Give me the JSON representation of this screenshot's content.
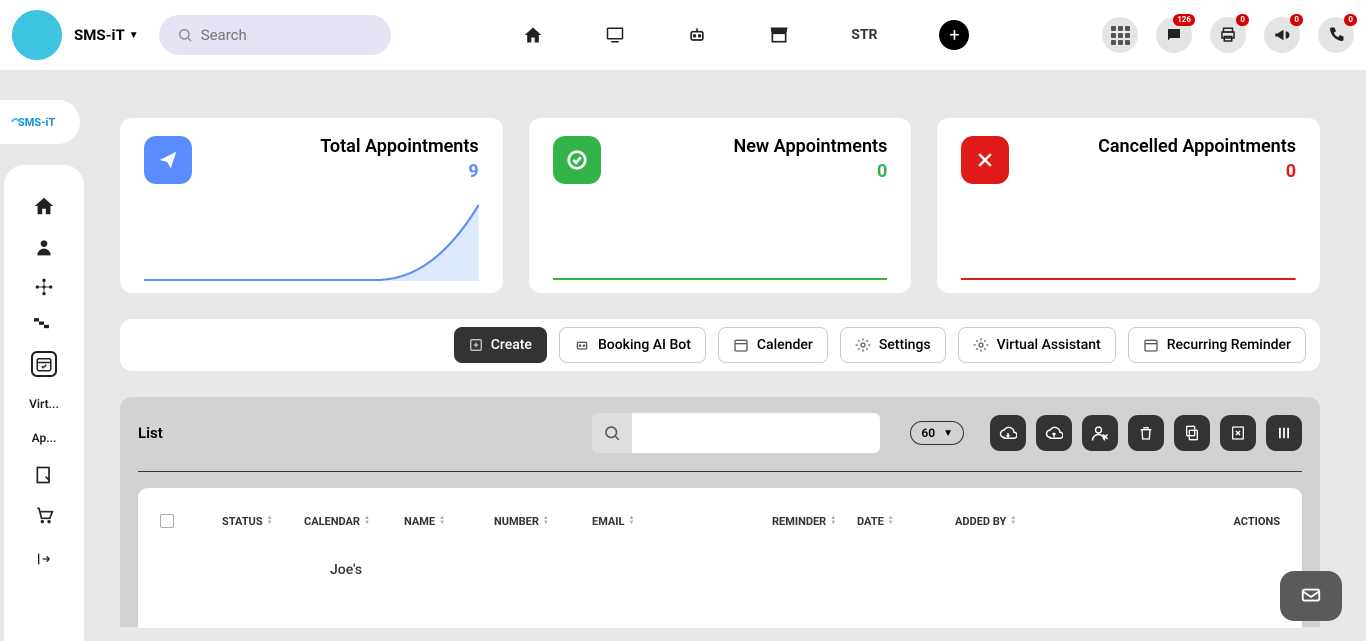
{
  "header": {
    "brand": "SMS-iT",
    "search_placeholder": "Search",
    "str_label": "STR",
    "badges": {
      "chat": "126",
      "print": "0",
      "megaphone": "0",
      "phone": "0"
    }
  },
  "sidebar": {
    "items": [
      "Virt...",
      "Ap..."
    ]
  },
  "cards": {
    "total": {
      "title": "Total Appointments",
      "value": "9"
    },
    "new": {
      "title": "New Appointments",
      "value": "0"
    },
    "cancelled": {
      "title": "Cancelled Appointments",
      "value": "0"
    }
  },
  "toolbar": {
    "create": "Create",
    "bookingbot": "Booking AI Bot",
    "calender": "Calender",
    "settings": "Settings",
    "va": "Virtual Assistant",
    "recurring": "Recurring Reminder"
  },
  "list": {
    "title": "List",
    "page_size": "60",
    "columns": {
      "status": "STATUS",
      "calendar": "CALENDAR",
      "name": "NAME",
      "number": "NUMBER",
      "email": "EMAIL",
      "reminder": "REMINDER",
      "date": "DATE",
      "addedby": "ADDED BY",
      "actions": "ACTIONS"
    },
    "rows": [
      {
        "calendar": "Joe's"
      }
    ]
  }
}
